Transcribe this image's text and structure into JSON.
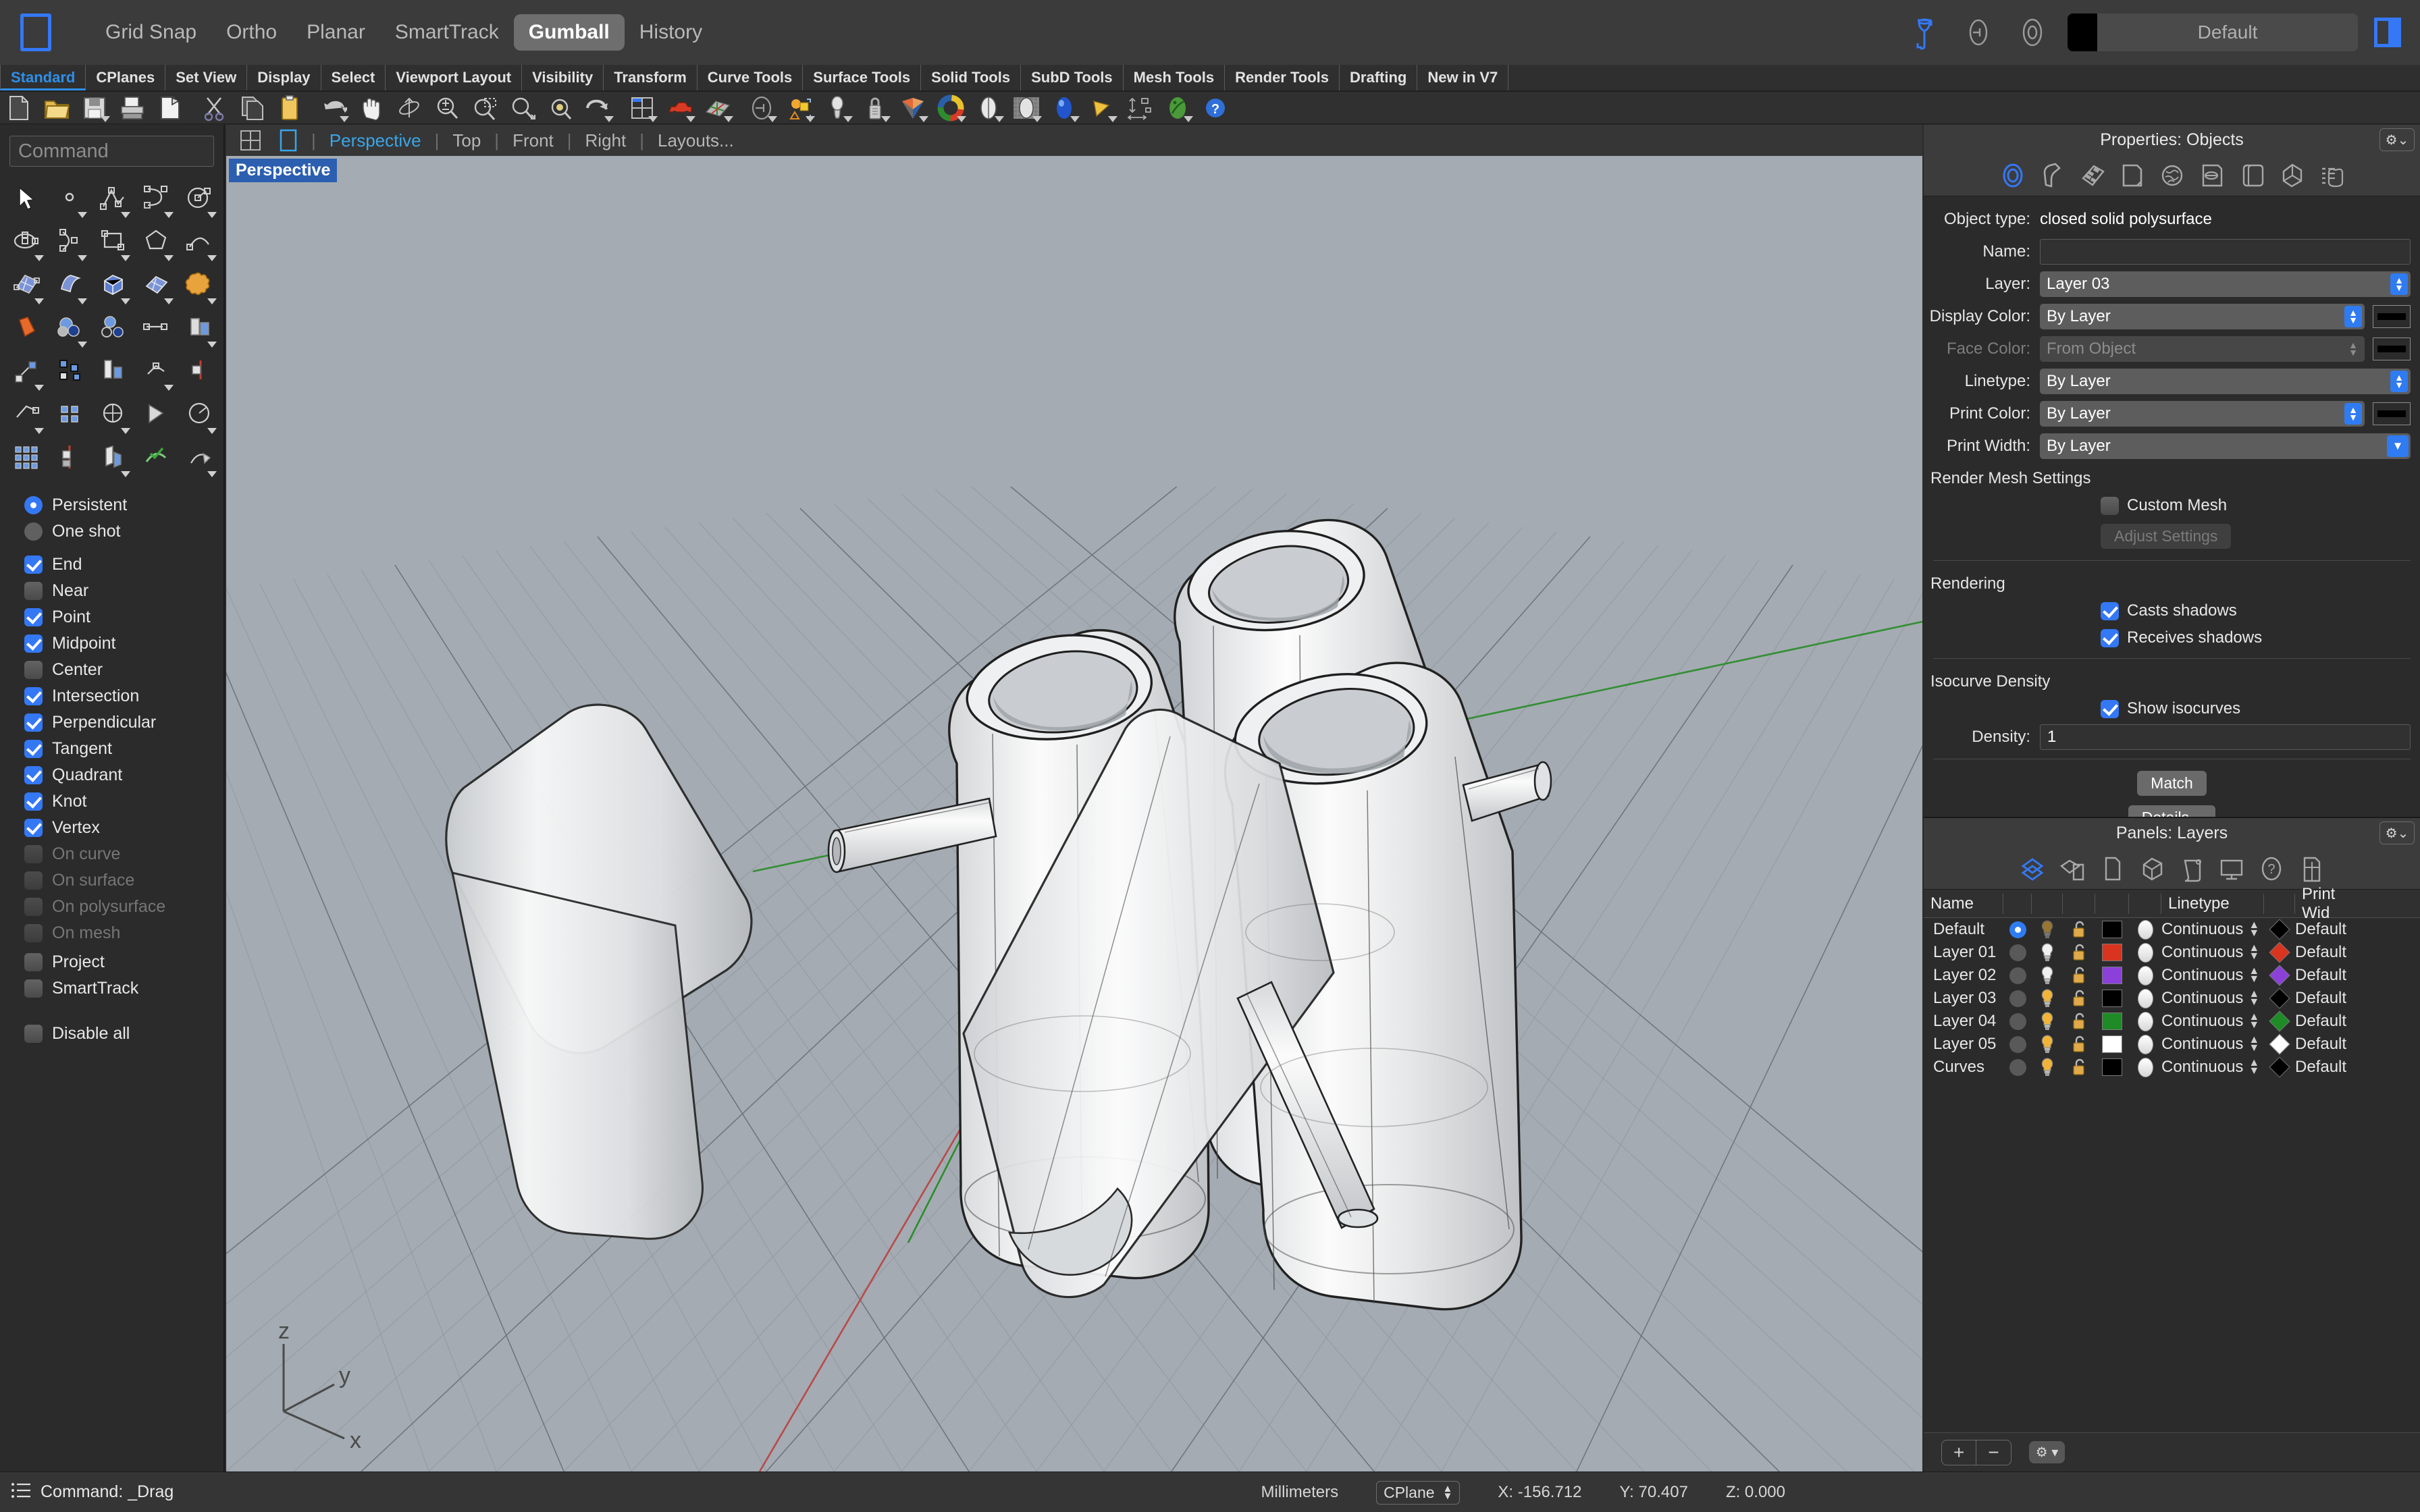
{
  "app": {
    "logo_icon": "rhino-logo-icon",
    "panel_toggle_icon": "right-panel-toggle-icon"
  },
  "topbar": {
    "toggles": [
      {
        "label": "Grid Snap",
        "active": false
      },
      {
        "label": "Ortho",
        "active": false
      },
      {
        "label": "Planar",
        "active": false
      },
      {
        "label": "SmartTrack",
        "active": false
      },
      {
        "label": "Gumball",
        "active": true
      },
      {
        "label": "History",
        "active": false
      }
    ],
    "filter_icon": "object-filter-icon",
    "lock_icon": "lock-oval-icon",
    "target_icon": "target-oval-icon",
    "current_layer_swatch": "#000000",
    "current_layer_name": "Default"
  },
  "tabs": [
    {
      "label": "Standard",
      "active": true
    },
    {
      "label": "CPlanes",
      "active": false
    },
    {
      "label": "Set View",
      "active": false
    },
    {
      "label": "Display",
      "active": false
    },
    {
      "label": "Select",
      "active": false
    },
    {
      "label": "Viewport Layout",
      "active": false
    },
    {
      "label": "Visibility",
      "active": false
    },
    {
      "label": "Transform",
      "active": false
    },
    {
      "label": "Curve Tools",
      "active": false
    },
    {
      "label": "Surface Tools",
      "active": false
    },
    {
      "label": "Solid Tools",
      "active": false
    },
    {
      "label": "SubD Tools",
      "active": false
    },
    {
      "label": "Mesh Tools",
      "active": false
    },
    {
      "label": "Render Tools",
      "active": false
    },
    {
      "label": "Drafting",
      "active": false
    },
    {
      "label": "New in V7",
      "active": false
    }
  ],
  "toolbar_icons": [
    "new-file-icon",
    "open-folder-icon",
    "save-icon",
    "print-icon",
    "cut-paste-icon",
    "scissors-cut-icon",
    "copy-icon",
    "paste-clipboard-icon",
    "undo-icon",
    "pan-hand-icon",
    "rotate-view-icon",
    "zoom-in-out-icon",
    "zoom-window-icon",
    "zoom-extents-icon",
    "zoom-selected-icon",
    "redo-icon",
    "viewport-layout-icon",
    "named-views-car-icon",
    "cplane-grid-icon",
    "lock-object-icon",
    "light-object-icon",
    "spotlight-icon",
    "lock-layer-icon",
    "render-preview-icon",
    "color-wheel-icon",
    "shaded-view-icon",
    "ghosted-view-icon",
    "rendered-view-icon",
    "arctic-view-icon",
    "dimension-icon",
    "render-globe-icon",
    "help-icon"
  ],
  "command": {
    "placeholder": "Command"
  },
  "palette_icons": [
    "select-arrow-icon",
    "point-icon",
    "polyline-icon",
    "curve-icon",
    "circle-icon",
    "ellipse-icon",
    "arc-icon",
    "rectangle-icon",
    "polygon-icon",
    "curve-tools-icon",
    "surface-from-points-icon",
    "loft-surface-icon",
    "box-solid-icon",
    "sphere-icon",
    "cylinder-icon",
    "planar-surface-icon",
    "boolean-union-icon",
    "extrude-icon",
    "fillet-icon",
    "offset-icon",
    "boolean-difference-icon",
    "boolean-split-icon",
    "join-icon",
    "explode-icon",
    "trim-icon",
    "transform-move-icon",
    "copy-object-icon",
    "scale-icon",
    "mirror-icon",
    "rotate-icon",
    "array-icon",
    "array-polar-icon",
    "analyze-icon",
    "check-object-icon",
    "dimension-tools-icon"
  ],
  "snaps": {
    "mode": [
      {
        "label": "Persistent",
        "checked": true
      },
      {
        "label": "One shot",
        "checked": false
      }
    ],
    "items": [
      {
        "label": "End",
        "checked": true,
        "disabled": false
      },
      {
        "label": "Near",
        "checked": false,
        "disabled": false
      },
      {
        "label": "Point",
        "checked": true,
        "disabled": false
      },
      {
        "label": "Midpoint",
        "checked": true,
        "disabled": false
      },
      {
        "label": "Center",
        "checked": false,
        "disabled": false
      },
      {
        "label": "Intersection",
        "checked": true,
        "disabled": false
      },
      {
        "label": "Perpendicular",
        "checked": true,
        "disabled": false
      },
      {
        "label": "Tangent",
        "checked": true,
        "disabled": false
      },
      {
        "label": "Quadrant",
        "checked": true,
        "disabled": false
      },
      {
        "label": "Knot",
        "checked": true,
        "disabled": false
      },
      {
        "label": "Vertex",
        "checked": true,
        "disabled": false
      },
      {
        "label": "On curve",
        "checked": false,
        "disabled": true
      },
      {
        "label": "On surface",
        "checked": false,
        "disabled": true
      },
      {
        "label": "On polysurface",
        "checked": false,
        "disabled": true
      },
      {
        "label": "On mesh",
        "checked": false,
        "disabled": true
      },
      {
        "label": "Project",
        "checked": false,
        "disabled": false
      },
      {
        "label": "SmartTrack",
        "checked": false,
        "disabled": false
      }
    ],
    "disable_all": {
      "label": "Disable all",
      "checked": false
    }
  },
  "viewport": {
    "layout_icons": [
      "four-view-layout-icon",
      "single-view-layout-icon"
    ],
    "tabs": [
      {
        "label": "Perspective",
        "active": true
      },
      {
        "label": "Top",
        "active": false
      },
      {
        "label": "Front",
        "active": false
      },
      {
        "label": "Right",
        "active": false
      },
      {
        "label": "Layouts...",
        "active": false
      }
    ],
    "label": "Perspective",
    "background_color": "#a4abb2",
    "axis_labels": {
      "x": "x",
      "y": "y",
      "z": "z"
    },
    "axis_colors": {
      "x": "#bb4444",
      "y": "#2d8c2d",
      "z": "#444444"
    }
  },
  "properties": {
    "title": "Properties: Objects",
    "gear_icon": "gear-dropdown-icon",
    "tab_icons": [
      "object-properties-icon",
      "material-icon",
      "texture-mapping-icon",
      "page-icon",
      "mesh-display-icon",
      "display-mode-icon",
      "object-icon",
      "subd-icon",
      "list-icon"
    ],
    "object_type_label": "Object type:",
    "object_type_value": "closed solid polysurface",
    "name_label": "Name:",
    "name_value": "",
    "layer_label": "Layer:",
    "layer_value": "Layer 03",
    "display_color_label": "Display Color:",
    "display_color_value": "By Layer",
    "display_color_swatch": "#000000",
    "face_color_label": "Face Color:",
    "face_color_value": "From Object",
    "face_color_swatch": "#000000",
    "face_color_disabled": true,
    "linetype_label": "Linetype:",
    "linetype_value": "By Layer",
    "print_color_label": "Print Color:",
    "print_color_value": "By Layer",
    "print_color_swatch": "#000000",
    "print_width_label": "Print Width:",
    "print_width_value": "By Layer",
    "render_mesh_heading": "Render Mesh Settings",
    "custom_mesh_label": "Custom Mesh",
    "custom_mesh_checked": false,
    "adjust_settings_label": "Adjust Settings",
    "adjust_settings_disabled": true,
    "rendering_heading": "Rendering",
    "casts_shadows_label": "Casts shadows",
    "casts_shadows_checked": true,
    "receives_shadows_label": "Receives shadows",
    "receives_shadows_checked": true,
    "isocurve_heading": "Isocurve Density",
    "show_isocurves_label": "Show isocurves",
    "show_isocurves_checked": true,
    "density_label": "Density:",
    "density_value": "1",
    "match_label": "Match",
    "details_label": "Details..."
  },
  "layers": {
    "title": "Panels: Layers",
    "gear_icon": "gear-dropdown-icon",
    "tab_icons": [
      "layers-icon",
      "layers-objects-icon",
      "document-icon",
      "block-icon",
      "scroll-icon",
      "display-icon",
      "help-circle-icon",
      "page-layout-icon"
    ],
    "columns": [
      "Name",
      "",
      "",
      "",
      "",
      "",
      "Linetype",
      "",
      "Print Wid"
    ],
    "rows": [
      {
        "name": "Default",
        "current": true,
        "bulb": "on-dim",
        "locked": false,
        "color": "#000000",
        "material": "white",
        "linetype": "Continuous",
        "print_color": "#000000",
        "print_width": "Default"
      },
      {
        "name": "Layer 01",
        "current": false,
        "bulb": "off",
        "locked": false,
        "color": "#d8341f",
        "material": "white",
        "linetype": "Continuous",
        "print_color": "#d8341f",
        "print_width": "Default"
      },
      {
        "name": "Layer 02",
        "current": false,
        "bulb": "off",
        "locked": false,
        "color": "#8b41d9",
        "material": "white",
        "linetype": "Continuous",
        "print_color": "#8b41d9",
        "print_width": "Default"
      },
      {
        "name": "Layer 03",
        "current": false,
        "bulb": "on",
        "locked": false,
        "color": "#000000",
        "material": "white",
        "linetype": "Continuous",
        "print_color": "#000000",
        "print_width": "Default"
      },
      {
        "name": "Layer 04",
        "current": false,
        "bulb": "on",
        "locked": false,
        "color": "#1e8b27",
        "material": "white",
        "linetype": "Continuous",
        "print_color": "#1e8b27",
        "print_width": "Default"
      },
      {
        "name": "Layer 05",
        "current": false,
        "bulb": "on",
        "locked": false,
        "color": "#ffffff",
        "material": "white",
        "linetype": "Continuous",
        "print_color": "#ffffff",
        "print_width": "Default"
      },
      {
        "name": "Curves",
        "current": false,
        "bulb": "on",
        "locked": false,
        "color": "#000000",
        "material": "white",
        "linetype": "Continuous",
        "print_color": "#000000",
        "print_width": "Default"
      }
    ],
    "footer": {
      "add_label": "+",
      "remove_label": "−",
      "gear_icon": "gear-icon",
      "chevron_icon": "chevron-down-icon"
    }
  },
  "statusbar": {
    "command_icon": "command-history-icon",
    "command_text": "Command: _Drag",
    "units": "Millimeters",
    "cplane_label": "CPlane",
    "x_label": "X: -156.712",
    "y_label": "Y: 70.407",
    "z_label": "Z: 0.000"
  }
}
